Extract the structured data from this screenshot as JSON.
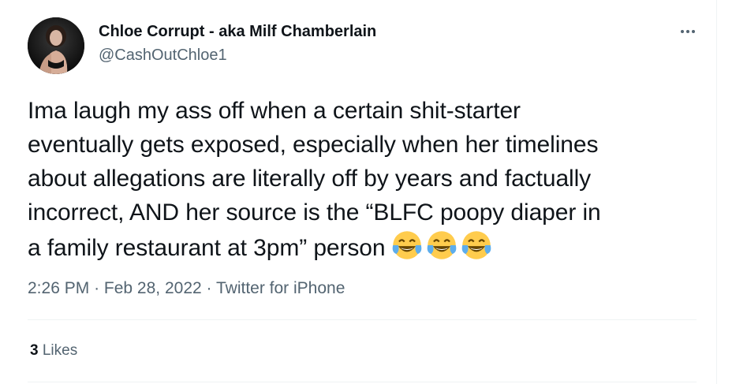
{
  "author": {
    "display_name": "Chloe Corrupt - aka Milf Chamberlain",
    "handle": "@CashOutChloe1"
  },
  "tweet": {
    "text": "Ima laugh my ass off when a certain shit-starter\neventually gets exposed, especially when her timelines\nabout allegations are literally off by years and factually\nincorrect, AND her source is the “BLFC poopy diaper in\na family restaurant at 3pm” person",
    "emojis": [
      "face-with-tears-of-joy-icon",
      "face-with-tears-of-joy-icon",
      "face-with-tears-of-joy-icon"
    ],
    "time": "2:26 PM",
    "separator": "·",
    "date": "Feb 28, 2022",
    "source": "Twitter for iPhone"
  },
  "stats": {
    "likes_count": "3",
    "likes_label": "Likes"
  },
  "colors": {
    "text": "#0f1419",
    "secondary": "#536471",
    "divider": "#eff3f4",
    "emoji_face": "#ffcc4d",
    "emoji_tears": "#5dadec"
  }
}
